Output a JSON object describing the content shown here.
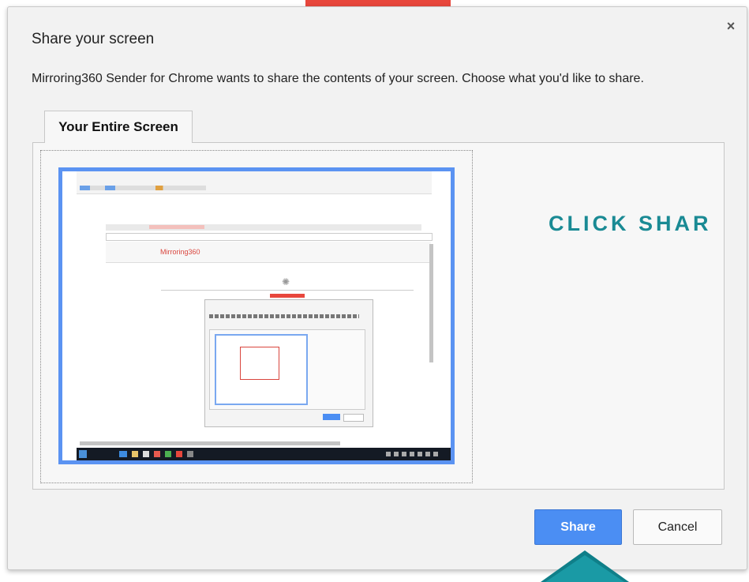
{
  "dialog": {
    "title": "Share your screen",
    "close_glyph": "×",
    "description": "Mirroring360 Sender for Chrome wants to share the contents of your screen. Choose what you'd like to share.",
    "tab_label": "Your Entire Screen",
    "share_label": "Share",
    "cancel_label": "Cancel"
  },
  "overlay": {
    "instruction": "CLICK SHAR"
  },
  "thumbnail": {
    "inner_title": "Mirroring360"
  },
  "colors": {
    "accent_red": "#e8473c",
    "share_blue": "#4b8ef3",
    "thumb_border": "#5b93f2",
    "instruction_teal": "#1a8a94",
    "arrow_teal": "#1a9aa5"
  }
}
